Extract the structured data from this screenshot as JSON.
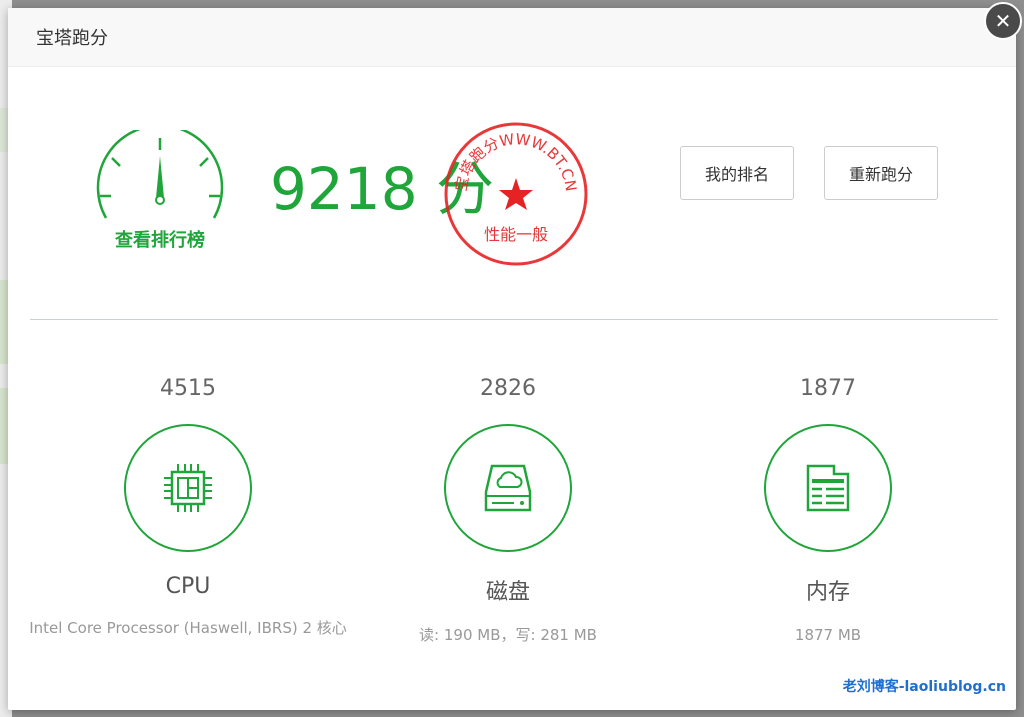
{
  "dialog": {
    "title": "宝塔跑分",
    "close_symbol": "✕"
  },
  "gauge": {
    "label": "查看排行榜"
  },
  "score": {
    "text": "9218 分"
  },
  "stamp": {
    "top_text": "宝塔跑分WWW.BT.CN",
    "bottom_text": "性能一般",
    "color": "#e52224"
  },
  "buttons": {
    "my_rank": "我的排名",
    "rerun": "重新跑分"
  },
  "metrics": [
    {
      "value": "4515",
      "name": "CPU",
      "detail": "Intel Core Processor (Haswell, IBRS) 2 核心",
      "icon": "cpu-chip-icon"
    },
    {
      "value": "2826",
      "name": "磁盘",
      "detail": "读: 190 MB，写: 281 MB",
      "icon": "cloud-disk-icon"
    },
    {
      "value": "1877",
      "name": "内存",
      "detail": "1877 MB",
      "icon": "memory-card-icon"
    }
  ],
  "watermark": "老刘博客-laoliublog.cn",
  "colors": {
    "accent": "#20a53a",
    "stamp": "#e52224",
    "watermark": "#1f6fd0"
  }
}
